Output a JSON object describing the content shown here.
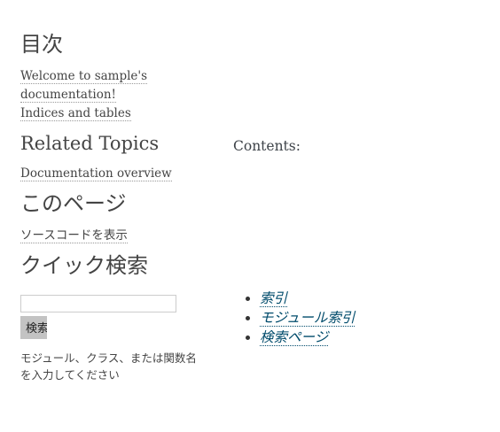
{
  "sidebar": {
    "toc_heading": "目次",
    "toc_links": [
      "Welcome to sample's documentation!",
      "Indices and tables"
    ],
    "related_heading": "Related Topics",
    "related_links": [
      "Documentation overview"
    ],
    "this_page_heading": "このページ",
    "show_source": "ソースコードを表示",
    "quick_search_heading": "クイック検索",
    "search_input_value": "",
    "search_button": "検索",
    "search_hint": "モジュール、クラス、または関数名を入力してください"
  },
  "main": {
    "contents_label": "Contents:",
    "index_links": [
      "索引",
      "モジュール索引",
      "検索ページ"
    ]
  },
  "colors": {
    "link": "#004b6b",
    "text": "#3e4349",
    "button_bg": "#c3c3c3"
  }
}
